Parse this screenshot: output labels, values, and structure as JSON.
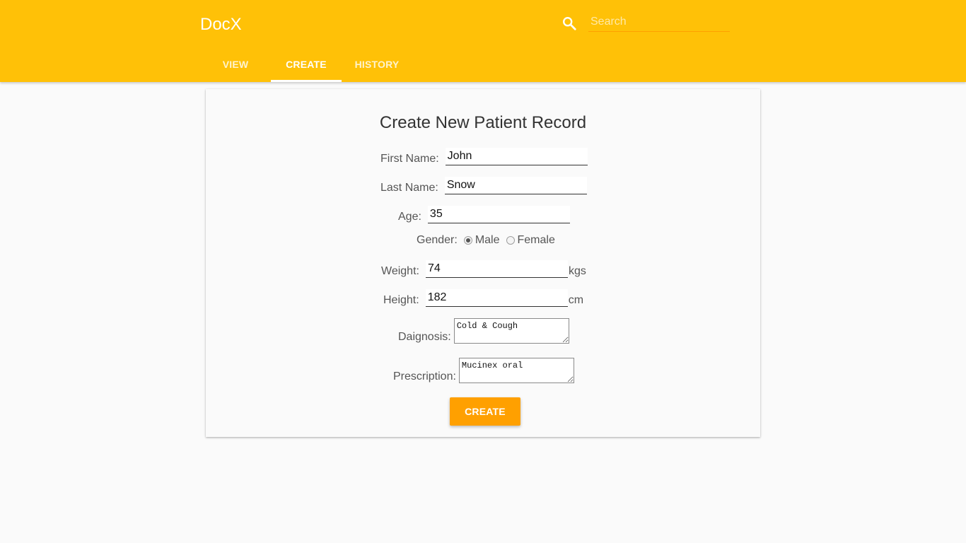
{
  "app": {
    "title": "DocX"
  },
  "search": {
    "placeholder": "Search",
    "value": ""
  },
  "tabs": [
    {
      "label": "VIEW",
      "active": false
    },
    {
      "label": "CREATE",
      "active": true
    },
    {
      "label": "HISTORY",
      "active": false
    }
  ],
  "form": {
    "title": "Create New Patient Record",
    "first_name": {
      "label": "First Name:",
      "value": "John"
    },
    "last_name": {
      "label": "Last Name:",
      "value": "Snow"
    },
    "age": {
      "label": "Age:",
      "value": "35"
    },
    "gender": {
      "label": "Gender:",
      "options": [
        "Male",
        "Female"
      ],
      "selected": "Male"
    },
    "weight": {
      "label": "Weight:",
      "value": "74",
      "unit": "kgs"
    },
    "height": {
      "label": "Height:",
      "value": "182",
      "unit": "cm"
    },
    "diagnosis": {
      "label": "Daignosis:",
      "value": "Cold & Cough"
    },
    "prescription": {
      "label": "Prescription:",
      "value": "Mucinex oral"
    },
    "submit_label": "CREATE"
  },
  "colors": {
    "appbar": "#ffc107",
    "button": "#ffa000",
    "background": "#fafafa"
  },
  "icons": {
    "search": "search-icon"
  }
}
